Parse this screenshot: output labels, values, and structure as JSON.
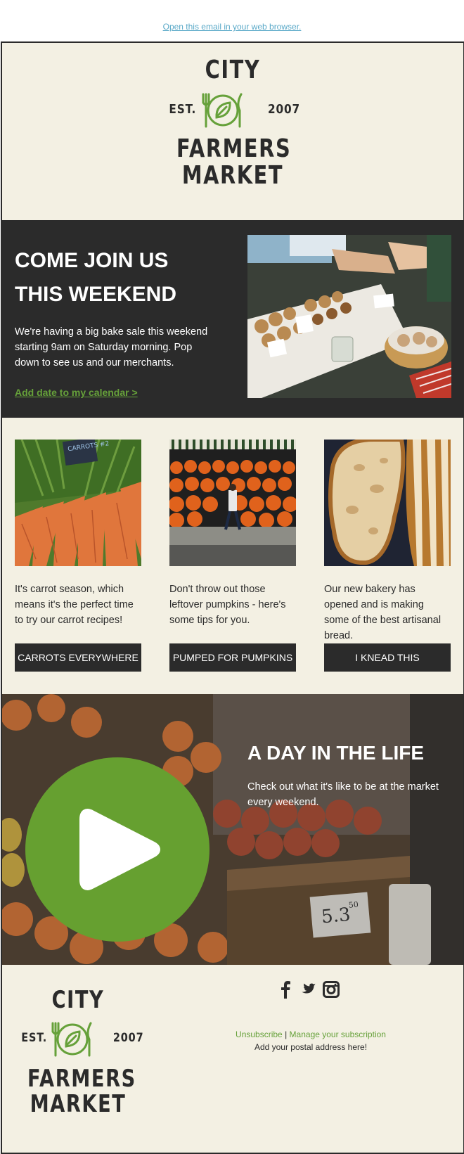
{
  "top": {
    "browser_link": "Open this email in your web browser."
  },
  "logo": {
    "city": "CITY",
    "est": "EST.",
    "year": "2007",
    "farmers": "FARMERS",
    "market": "MARKET"
  },
  "hero": {
    "heading_line1": "COME JOIN US",
    "heading_line2": "THIS WEEKEND",
    "body": "We're having a big bake sale this weekend starting 9am on Saturday morning. Pop down to see us and our merchants.",
    "calendar_link": "Add date to my calendar >"
  },
  "cards": [
    {
      "text": "It's carrot season, which means it's the perfect time to try our carrot recipes!",
      "button": "CARROTS EVERYWHERE",
      "sign": "CARROTS #2"
    },
    {
      "text": "Don't throw out those leftover pumpkins - here's some tips for you.",
      "button": "PUMPED FOR PUMPKINS"
    },
    {
      "text": "Our new bakery has opened and is making some of the best artisanal bread.",
      "button": "I KNEAD THIS"
    }
  ],
  "video": {
    "title": "A DAY IN THE LIFE",
    "description": "Check out what it's like to be at the market every weekend.",
    "price_tag": "5.3",
    "price_cents": "50"
  },
  "footer": {
    "social_icons": [
      "facebook-icon",
      "twitter-icon",
      "instagram-icon"
    ],
    "unsubscribe": "Unsubscribe",
    "separator": "|",
    "manage": "Manage your subscription",
    "address": "Add your postal address here!"
  },
  "colors": {
    "dark": "#2b2b2b",
    "cream": "#f3f0e3",
    "green": "#66a13a",
    "link_blue": "#5aa9c8"
  }
}
